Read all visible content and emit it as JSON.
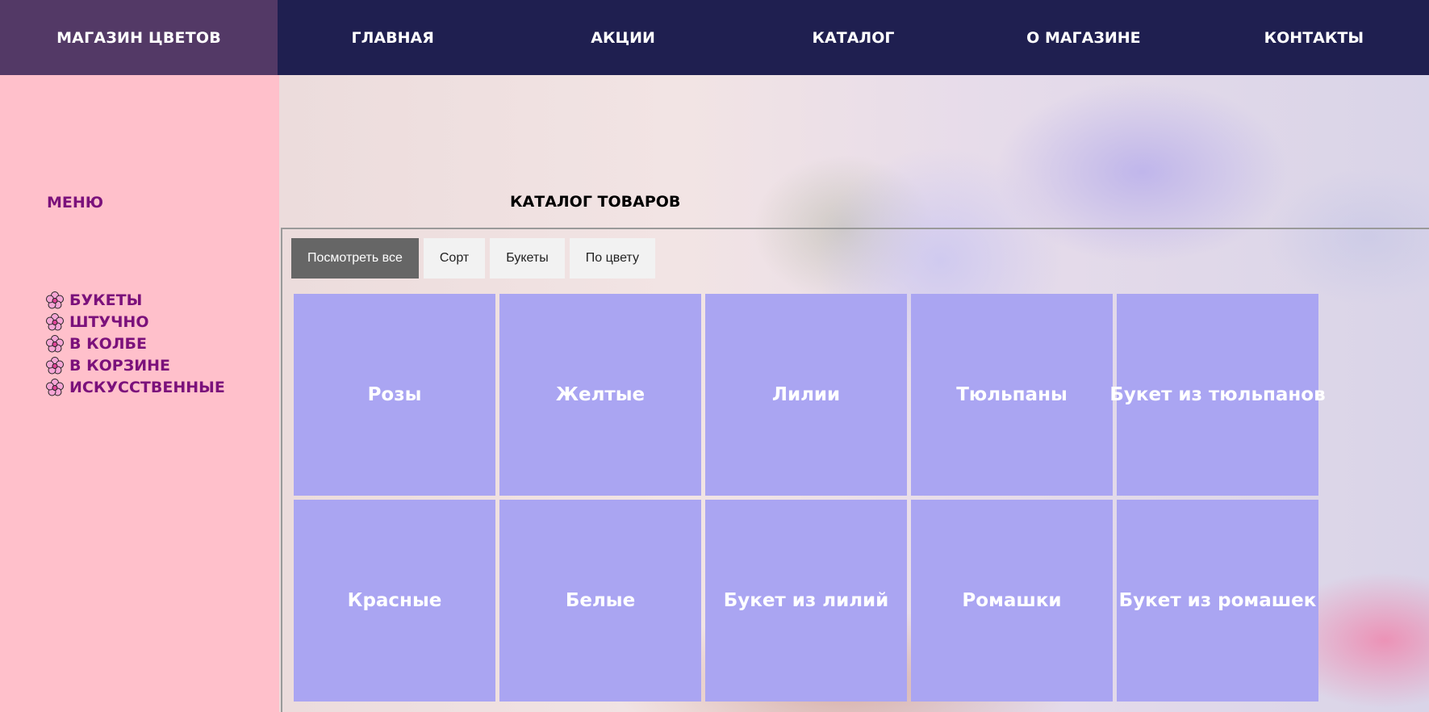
{
  "header": {
    "brand": "МАГАЗИН ЦВЕТОВ",
    "nav": [
      "ГЛАВНАЯ",
      "АКЦИИ",
      "КАТАЛОГ",
      "О МАГАЗИНЕ",
      "КОНТАКТЫ"
    ]
  },
  "sidebar": {
    "title": "МЕНЮ",
    "items": [
      "БУКЕТЫ",
      "ШТУЧНО",
      "В КОЛБЕ",
      "В КОРЗИНЕ",
      "ИСКУССТВЕННЫЕ"
    ],
    "item_icon": "flower-icon"
  },
  "catalog": {
    "title": "КАТАЛОГ ТОВАРОВ",
    "filters": [
      "Посмотреть все",
      "Сорт",
      "Букеты",
      "По цвету"
    ],
    "active_filter": "Посмотреть все",
    "tiles": [
      "Розы",
      "Желтые",
      "Лилии",
      "Тюльпаны",
      "Букет из тюльпанов",
      "Красные",
      "Белые",
      "Букет из лилий",
      "Ромашки",
      "Букет из ромашек"
    ]
  },
  "colors": {
    "topbar": "#1f1f50",
    "brand_bg": "#533966",
    "sidebar_bg": "#ffc0cb",
    "menu_text": "#7b117b",
    "tile_bg": "#aaa5f2",
    "active_filter_bg": "#666666"
  }
}
